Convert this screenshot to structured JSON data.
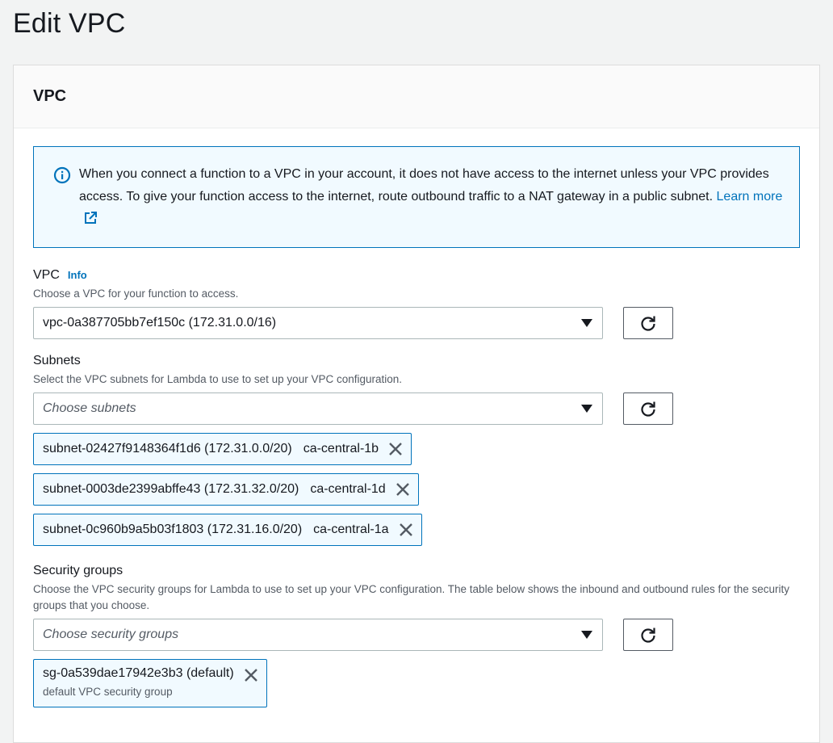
{
  "page": {
    "title": "Edit VPC"
  },
  "panel": {
    "title": "VPC"
  },
  "alert": {
    "text": "When you connect a function to a VPC in your account, it does not have access to the internet unless your VPC provides access. To give your function access to the internet, route outbound traffic to a NAT gateway in a public subnet.",
    "link": "Learn more"
  },
  "vpc": {
    "label": "VPC",
    "info": "Info",
    "description": "Choose a VPC for your function to access.",
    "value": "vpc-0a387705bb7ef150c (172.31.0.0/16)"
  },
  "subnets": {
    "label": "Subnets",
    "description": "Select the VPC subnets for Lambda to use to set up your VPC configuration.",
    "placeholder": "Choose subnets",
    "selected": [
      {
        "id": "subnet-02427f9148364f1d6 (172.31.0.0/20)",
        "zone": "ca-central-1b"
      },
      {
        "id": "subnet-0003de2399abffe43 (172.31.32.0/20)",
        "zone": "ca-central-1d"
      },
      {
        "id": "subnet-0c960b9a5b03f1803 (172.31.16.0/20)",
        "zone": "ca-central-1a"
      }
    ]
  },
  "security_groups": {
    "label": "Security groups",
    "description": "Choose the VPC security groups for Lambda to use to set up your VPC configuration. The table below shows the inbound and outbound rules for the security groups that you choose.",
    "placeholder": "Choose security groups",
    "selected": [
      {
        "id": "sg-0a539dae17942e3b3 (default)",
        "description": "default VPC security group"
      }
    ]
  },
  "colors": {
    "accent": "#0073bb",
    "alert_bg": "#f1faff",
    "page_bg": "#f2f3f3"
  },
  "icons": {
    "info": "info-circle-icon",
    "external": "external-link-icon",
    "refresh": "refresh-icon",
    "dropdown": "caret-down-icon",
    "remove": "close-icon"
  }
}
